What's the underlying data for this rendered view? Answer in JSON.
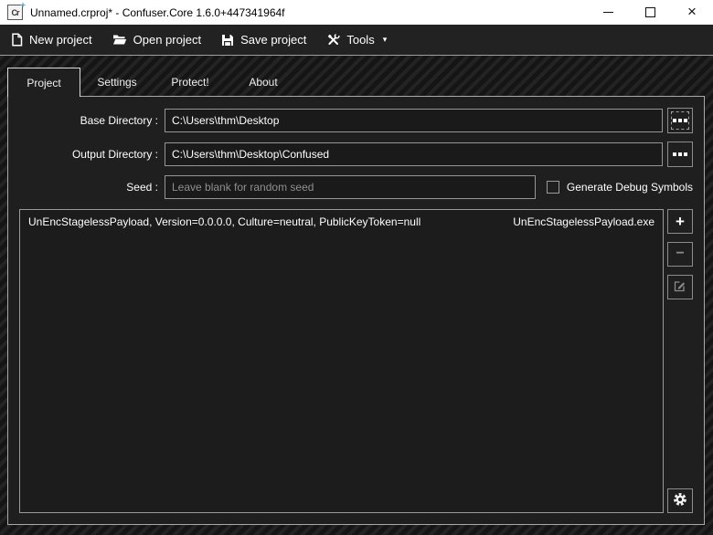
{
  "window": {
    "title": "Unnamed.crproj* - Confuser.Core 1.6.0+447341964f",
    "app_icon": {
      "text": "Cr",
      "plus_badge": "+",
      "accent_color": "#2bb3e8"
    }
  },
  "icons": {
    "close_glyph": "×",
    "tools_caret": "▾",
    "add_glyph": "+",
    "remove_glyph": "−"
  },
  "toolbar": {
    "items": [
      {
        "label": "New project",
        "icon": "new-document-icon"
      },
      {
        "label": "Open project",
        "icon": "open-folder-icon"
      },
      {
        "label": "Save project",
        "icon": "save-floppy-icon"
      },
      {
        "label": "Tools",
        "icon": "tools-icon",
        "has_dropdown": true
      }
    ]
  },
  "tabs": [
    {
      "label": "Project",
      "selected": true
    },
    {
      "label": "Settings",
      "selected": false
    },
    {
      "label": "Protect!",
      "selected": false
    },
    {
      "label": "About",
      "selected": false
    }
  ],
  "form": {
    "base_directory": {
      "label": "Base Directory :",
      "value": "C:\\Users\\thm\\Desktop",
      "browse_icon": "ellipsis-icon"
    },
    "output_directory": {
      "label": "Output Directory :",
      "value": "C:\\Users\\thm\\Desktop\\Confused",
      "browse_icon": "ellipsis-icon"
    },
    "seed": {
      "label": "Seed :",
      "value": "",
      "placeholder": "Leave blank for random seed"
    },
    "debug_symbols": {
      "label": "Generate Debug Symbols",
      "checked": false
    }
  },
  "modules": [
    {
      "assembly": "UnEncStagelessPayload, Version=0.0.0.0, Culture=neutral, PublicKeyToken=null",
      "file": "UnEncStagelessPayload.exe"
    }
  ],
  "module_actions": {
    "add": {
      "icon": "plus-icon",
      "enabled": true
    },
    "remove": {
      "icon": "minus-icon",
      "enabled": false
    },
    "edit": {
      "icon": "edit-icon",
      "enabled": false
    },
    "advanced": {
      "icon": "gear-icon",
      "enabled": true
    }
  },
  "colors": {
    "titlebar_bg": "#ffffff",
    "toolbar_bg": "#222222",
    "panel_bg": "#1f1f1f",
    "stripe_light": "#232323",
    "stripe_dark": "#151515",
    "border_light": "#a9a9a9",
    "accent_blue": "#2bb3e8",
    "disabled_gray": "#8c8c8c"
  }
}
